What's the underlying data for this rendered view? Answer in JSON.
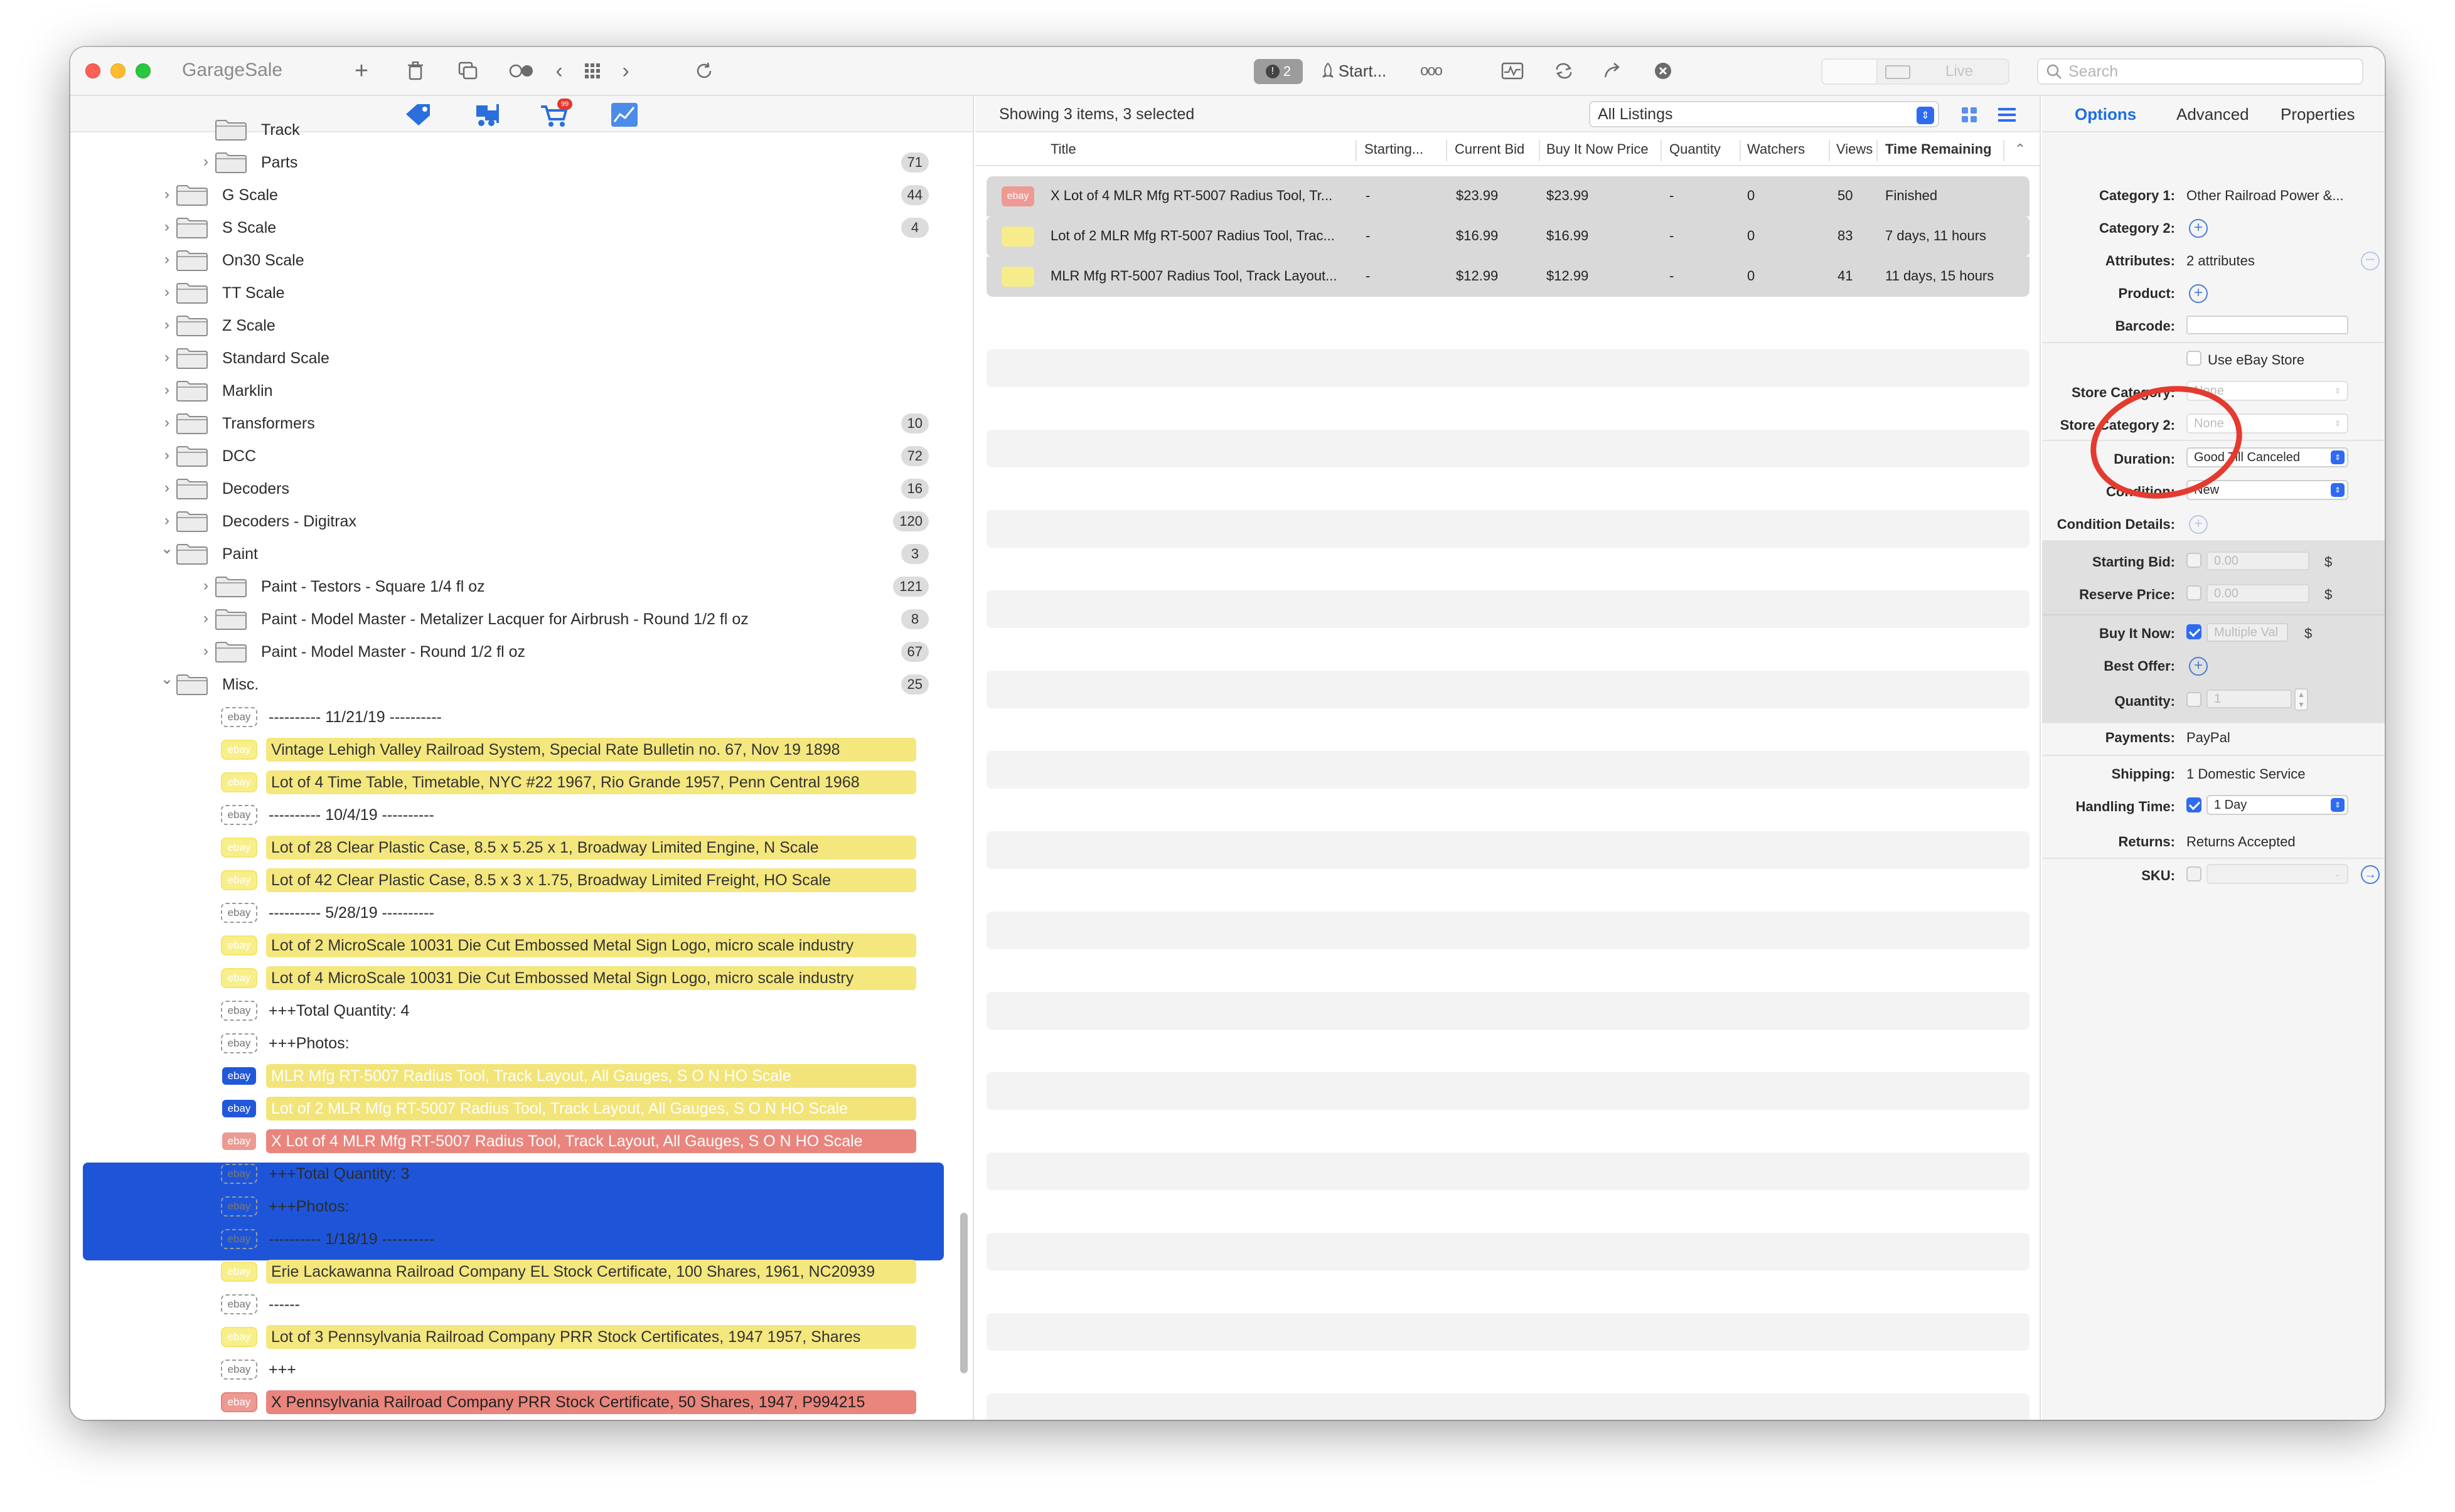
{
  "app_title": "GarageSale",
  "toolbar": {
    "alert_count": "2",
    "start_label": "Start...",
    "more_label": "ooo",
    "live_label": "Live",
    "search_placeholder": "Search"
  },
  "sidebar": {
    "cart_badge": "99",
    "rows": [
      {
        "type": "folder",
        "indent": 1,
        "label": "Track",
        "count": "",
        "chevron": "none"
      },
      {
        "type": "folder",
        "indent": 1,
        "label": "Parts",
        "count": "71",
        "chevron": "right"
      },
      {
        "type": "folder",
        "indent": 0,
        "label": "G Scale",
        "count": "44",
        "chevron": "right"
      },
      {
        "type": "folder",
        "indent": 0,
        "label": "S Scale",
        "count": "4",
        "chevron": "right"
      },
      {
        "type": "folder",
        "indent": 0,
        "label": "On30 Scale",
        "count": "",
        "chevron": "right"
      },
      {
        "type": "folder",
        "indent": 0,
        "label": "TT Scale",
        "count": "",
        "chevron": "right"
      },
      {
        "type": "folder",
        "indent": 0,
        "label": "Z Scale",
        "count": "",
        "chevron": "right"
      },
      {
        "type": "folder",
        "indent": 0,
        "label": "Standard Scale",
        "count": "",
        "chevron": "right"
      },
      {
        "type": "folder",
        "indent": 0,
        "label": "Marklin",
        "count": "",
        "chevron": "right"
      },
      {
        "type": "folder",
        "indent": 0,
        "label": "Transformers",
        "count": "10",
        "chevron": "right"
      },
      {
        "type": "folder",
        "indent": 0,
        "label": "DCC",
        "count": "72",
        "chevron": "right"
      },
      {
        "type": "folder",
        "indent": 0,
        "label": "Decoders",
        "count": "16",
        "chevron": "right"
      },
      {
        "type": "folder",
        "indent": 0,
        "label": "Decoders - Digitrax",
        "count": "120",
        "chevron": "right"
      },
      {
        "type": "folder",
        "indent": 0,
        "label": "Paint",
        "count": "3",
        "chevron": "down"
      },
      {
        "type": "folder",
        "indent": 1,
        "label": "Paint - Testors - Square 1/4 fl oz",
        "count": "121",
        "chevron": "right"
      },
      {
        "type": "folder",
        "indent": 1,
        "label": "Paint - Model Master - Metalizer Lacquer for Airbrush - Round 1/2 fl oz",
        "count": "8",
        "chevron": "right"
      },
      {
        "type": "folder",
        "indent": 1,
        "label": "Paint - Model Master - Round 1/2 fl oz",
        "count": "67",
        "chevron": "right"
      },
      {
        "type": "folder",
        "indent": 0,
        "label": "Misc.",
        "count": "25",
        "chevron": "down"
      },
      {
        "type": "item",
        "style": "plain",
        "label": "---------- 11/21/19 ----------"
      },
      {
        "type": "item",
        "style": "yellow",
        "label": "Vintage Lehigh Valley Railroad System, Special Rate Bulletin no. 67, Nov 19 1898"
      },
      {
        "type": "item",
        "style": "yellow",
        "label": "Lot of 4 Time Table, Timetable, NYC #22 1967, Rio Grande 1957, Penn Central 1968"
      },
      {
        "type": "item",
        "style": "plain",
        "label": "---------- 10/4/19 ----------"
      },
      {
        "type": "item",
        "style": "yellow",
        "label": "Lot of 28 Clear Plastic Case, 8.5 x 5.25 x 1, Broadway Limited Engine, N Scale"
      },
      {
        "type": "item",
        "style": "yellow",
        "label": "Lot of 42 Clear Plastic Case, 8.5 x 3 x 1.75, Broadway Limited Freight, HO Scale"
      },
      {
        "type": "item",
        "style": "plain",
        "label": "---------- 5/28/19 ----------"
      },
      {
        "type": "item",
        "style": "yellow",
        "label": "Lot of 2 MicroScale 10031 Die Cut Embossed Metal Sign Logo, micro scale industry"
      },
      {
        "type": "item",
        "style": "yellow",
        "label": "Lot of 4 MicroScale 10031 Die Cut Embossed Metal Sign Logo, micro scale industry"
      },
      {
        "type": "item",
        "style": "plain",
        "label": "+++Total Quantity: 4"
      },
      {
        "type": "item",
        "style": "plain",
        "label": "+++Photos:"
      },
      {
        "type": "item",
        "style": "yellow",
        "selected": true,
        "label": "MLR Mfg RT-5007 Radius Tool, Track Layout, All Gauges, S O N HO Scale"
      },
      {
        "type": "item",
        "style": "yellow",
        "selected": true,
        "label": "Lot of 2 MLR Mfg RT-5007 Radius Tool, Track Layout, All Gauges, S O N HO Scale"
      },
      {
        "type": "item",
        "style": "red",
        "selected": true,
        "label": "X Lot of 4 MLR Mfg RT-5007 Radius Tool, Track Layout, All Gauges, S O N HO Scale"
      },
      {
        "type": "item",
        "style": "plain",
        "label": "+++Total Quantity: 3"
      },
      {
        "type": "item",
        "style": "plain",
        "label": "+++Photos:"
      },
      {
        "type": "item",
        "style": "plain",
        "label": "---------- 1/18/19 ----------"
      },
      {
        "type": "item",
        "style": "yellow",
        "label": "Erie Lackawanna Railroad Company EL Stock Certificate, 100 Shares, 1961, NC20939"
      },
      {
        "type": "item",
        "style": "plain",
        "label": "------"
      },
      {
        "type": "item",
        "style": "yellow",
        "label": "Lot of 3 Pennsylvania Railroad Company PRR Stock Certificates, 1947 1957, Shares"
      },
      {
        "type": "item",
        "style": "plain",
        "label": "+++"
      },
      {
        "type": "item",
        "style": "red",
        "label": "X Pennsylvania Railroad Company PRR Stock Certificate, 50 Shares, 1947, P994215"
      }
    ],
    "ebay_badge": "ebay"
  },
  "listing": {
    "showing": "Showing 3 items, 3 selected",
    "filter": "All Listings",
    "columns": [
      "Title",
      "Starting...",
      "Current Bid",
      "Buy It Now Price",
      "Quantity",
      "Watchers",
      "Views",
      "Time Remaining"
    ],
    "rows": [
      {
        "status": "red",
        "title": "X Lot of 4 MLR Mfg RT-5007 Radius Tool, Tr...",
        "starting": "-",
        "current_bid": "$23.99",
        "buy_it_now": "$23.99",
        "quantity": "-",
        "watchers": "0",
        "views": "50",
        "time_remaining": "Finished"
      },
      {
        "status": "yellow",
        "title": "Lot of 2 MLR Mfg RT-5007 Radius Tool, Trac...",
        "starting": "-",
        "current_bid": "$16.99",
        "buy_it_now": "$16.99",
        "quantity": "-",
        "watchers": "0",
        "views": "83",
        "time_remaining": "7 days, 11 hours"
      },
      {
        "status": "yellow",
        "title": "MLR Mfg RT-5007 Radius Tool, Track Layout...",
        "starting": "-",
        "current_bid": "$12.99",
        "buy_it_now": "$12.99",
        "quantity": "-",
        "watchers": "0",
        "views": "41",
        "time_remaining": "11 days, 15 hours"
      }
    ]
  },
  "inspector": {
    "tabs": [
      "Options",
      "Advanced",
      "Properties"
    ],
    "active_tab": "Options",
    "category1_label": "Category 1:",
    "category1_value": "Other Railroad Power &...",
    "category2_label": "Category 2:",
    "attributes_label": "Attributes:",
    "attributes_value": "2 attributes",
    "product_label": "Product:",
    "barcode_label": "Barcode:",
    "use_store_label": "Use eBay Store",
    "store_cat_label": "Store Category:",
    "store_cat2_label": "Store Category 2:",
    "store_cat_value": "None",
    "store_cat2_value": "None",
    "duration_label": "Duration:",
    "duration_value": "Good Till Canceled",
    "condition_label": "Condition:",
    "condition_value": "New",
    "condition_details_label": "Condition Details:",
    "starting_bid_label": "Starting Bid:",
    "starting_bid_value": "0.00",
    "reserve_label": "Reserve Price:",
    "reserve_value": "0.00",
    "buy_it_now_label": "Buy It Now:",
    "buy_it_now_value": "Multiple Val",
    "best_offer_label": "Best Offer:",
    "quantity_label": "Quantity:",
    "quantity_value": "1",
    "payments_label": "Payments:",
    "payments_value": "PayPal",
    "shipping_label": "Shipping:",
    "shipping_value": "1 Domestic Service",
    "handling_label": "Handling Time:",
    "handling_value": "1 Day",
    "returns_label": "Returns:",
    "returns_value": "Returns Accepted",
    "sku_label": "SKU:",
    "currency": "$"
  },
  "colors": {
    "accent": "#2e6bf0",
    "selection": "#1e55d8",
    "yellow_item": "#f4e77e",
    "red_item": "#e9857d",
    "annotation_circle": "#e43a2f"
  }
}
